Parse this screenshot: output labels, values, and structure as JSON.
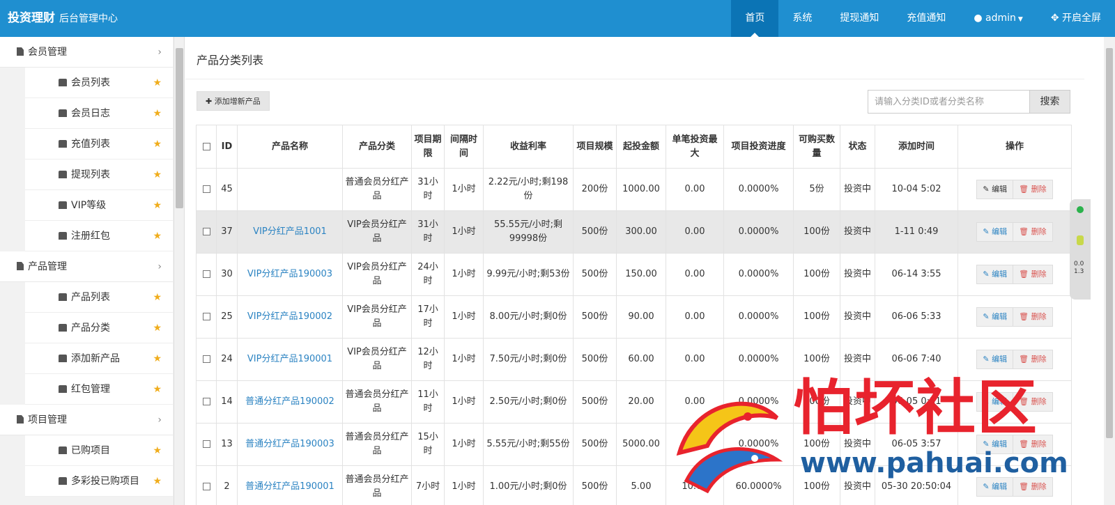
{
  "brand": {
    "title": "投资理财",
    "subtitle": "后台管理中心"
  },
  "topnav": {
    "items": [
      "首页",
      "系统",
      "提现通知",
      "充值通知"
    ],
    "user": "admin",
    "fullscreen": "开启全屏"
  },
  "sidebar": {
    "groups": [
      {
        "label": "会员管理",
        "items": [
          "会员列表",
          "会员日志",
          "充值列表",
          "提现列表",
          "VIP等级",
          "注册红包"
        ]
      },
      {
        "label": "产品管理",
        "items": [
          "产品列表",
          "产品分类",
          "添加新产品",
          "红包管理"
        ]
      },
      {
        "label": "项目管理",
        "items": [
          "已购项目",
          "多彩投已购项目"
        ]
      }
    ]
  },
  "page": {
    "title": "产品分类列表",
    "add_label": "添加增新产品",
    "search_placeholder": "请输入分类ID或者分类名称",
    "search_label": "搜索"
  },
  "table": {
    "headers": [
      "ID",
      "产品名称",
      "产品分类",
      "项目期限",
      "间隔时间",
      "收益利率",
      "项目规模",
      "起投金额",
      "单笔投资最大",
      "项目投资进度",
      "可购买数量",
      "状态",
      "添加时间",
      "操作"
    ],
    "rows": [
      {
        "id": "45",
        "name": "",
        "category": "普通会员分红产品",
        "term": "31小时",
        "interval": "1小时",
        "rate": "2.22元/小时;剩198份",
        "scale": "200份",
        "min": "1000.00",
        "max": "0.00",
        "progress": "0.0000%",
        "qty": "5份",
        "status": "投资中",
        "time": "10-04 5:02",
        "edit": "编辑",
        "del": "删除"
      },
      {
        "id": "37",
        "name": "VIP分红产品1001",
        "category": "VIP会员分红产品",
        "term": "31小时",
        "interval": "1小时",
        "rate": "55.55元/小时;剩99998份",
        "scale": "500份",
        "min": "300.00",
        "max": "0.00",
        "progress": "0.0000%",
        "qty": "100份",
        "status": "投资中",
        "time": "1-11 0:49",
        "edit": "编辑",
        "del": "删除"
      },
      {
        "id": "30",
        "name": "VIP分红产品190003",
        "category": "VIP会员分红产品",
        "term": "24小时",
        "interval": "1小时",
        "rate": "9.99元/小时;剩53份",
        "scale": "500份",
        "min": "150.00",
        "max": "0.00",
        "progress": "0.0000%",
        "qty": "100份",
        "status": "投资中",
        "time": "06-14 3:55",
        "edit": "编辑",
        "del": "删除"
      },
      {
        "id": "25",
        "name": "VIP分红产品190002",
        "category": "VIP会员分红产品",
        "term": "17小时",
        "interval": "1小时",
        "rate": "8.00元/小时;剩0份",
        "scale": "500份",
        "min": "90.00",
        "max": "0.00",
        "progress": "0.0000%",
        "qty": "100份",
        "status": "投资中",
        "time": "06-06 5:33",
        "edit": "编辑",
        "del": "删除"
      },
      {
        "id": "24",
        "name": "VIP分红产品190001",
        "category": "VIP会员分红产品",
        "term": "12小时",
        "interval": "1小时",
        "rate": "7.50元/小时;剩0份",
        "scale": "500份",
        "min": "60.00",
        "max": "0.00",
        "progress": "0.0000%",
        "qty": "100份",
        "status": "投资中",
        "time": "06-06 7:40",
        "edit": "编辑",
        "del": "删除"
      },
      {
        "id": "14",
        "name": "普通分红产品190002",
        "category": "普通会员分红产品",
        "term": "11小时",
        "interval": "1小时",
        "rate": "2.50元/小时;剩0份",
        "scale": "500份",
        "min": "20.00",
        "max": "0.00",
        "progress": "0.0000%",
        "qty": "100份",
        "status": "投资中",
        "time": "06-05 0:31",
        "edit": "编辑",
        "del": "删除"
      },
      {
        "id": "13",
        "name": "普通分红产品190003",
        "category": "普通会员分红产品",
        "term": "15小时",
        "interval": "1小时",
        "rate": "5.55元/小时;剩55份",
        "scale": "500份",
        "min": "5000.00",
        "max": "0.00",
        "progress": "0.0000%",
        "qty": "100份",
        "status": "投资中",
        "time": "06-05 3:57",
        "edit": "编辑",
        "del": "删除"
      },
      {
        "id": "2",
        "name": "普通分红产品190001",
        "category": "普通会员分红产品",
        "term": "7小时",
        "interval": "1小时",
        "rate": "1.00元/小时;剩0份",
        "scale": "500份",
        "min": "5.00",
        "max": "10.00",
        "progress": "60.0000%",
        "qty": "100份",
        "status": "投资中",
        "time": "05-30 20:50:04",
        "edit": "编辑",
        "del": "删除"
      }
    ]
  },
  "widget": {
    "up": "0.0",
    "down": "1.3"
  },
  "watermark": {
    "text": "怕坏社区",
    "url": "www.pahuai.com"
  },
  "colors": {
    "topbar": "#1f8fd0",
    "link": "#2b83c2",
    "star": "#f0ad1c",
    "danger": "#d9534f"
  }
}
